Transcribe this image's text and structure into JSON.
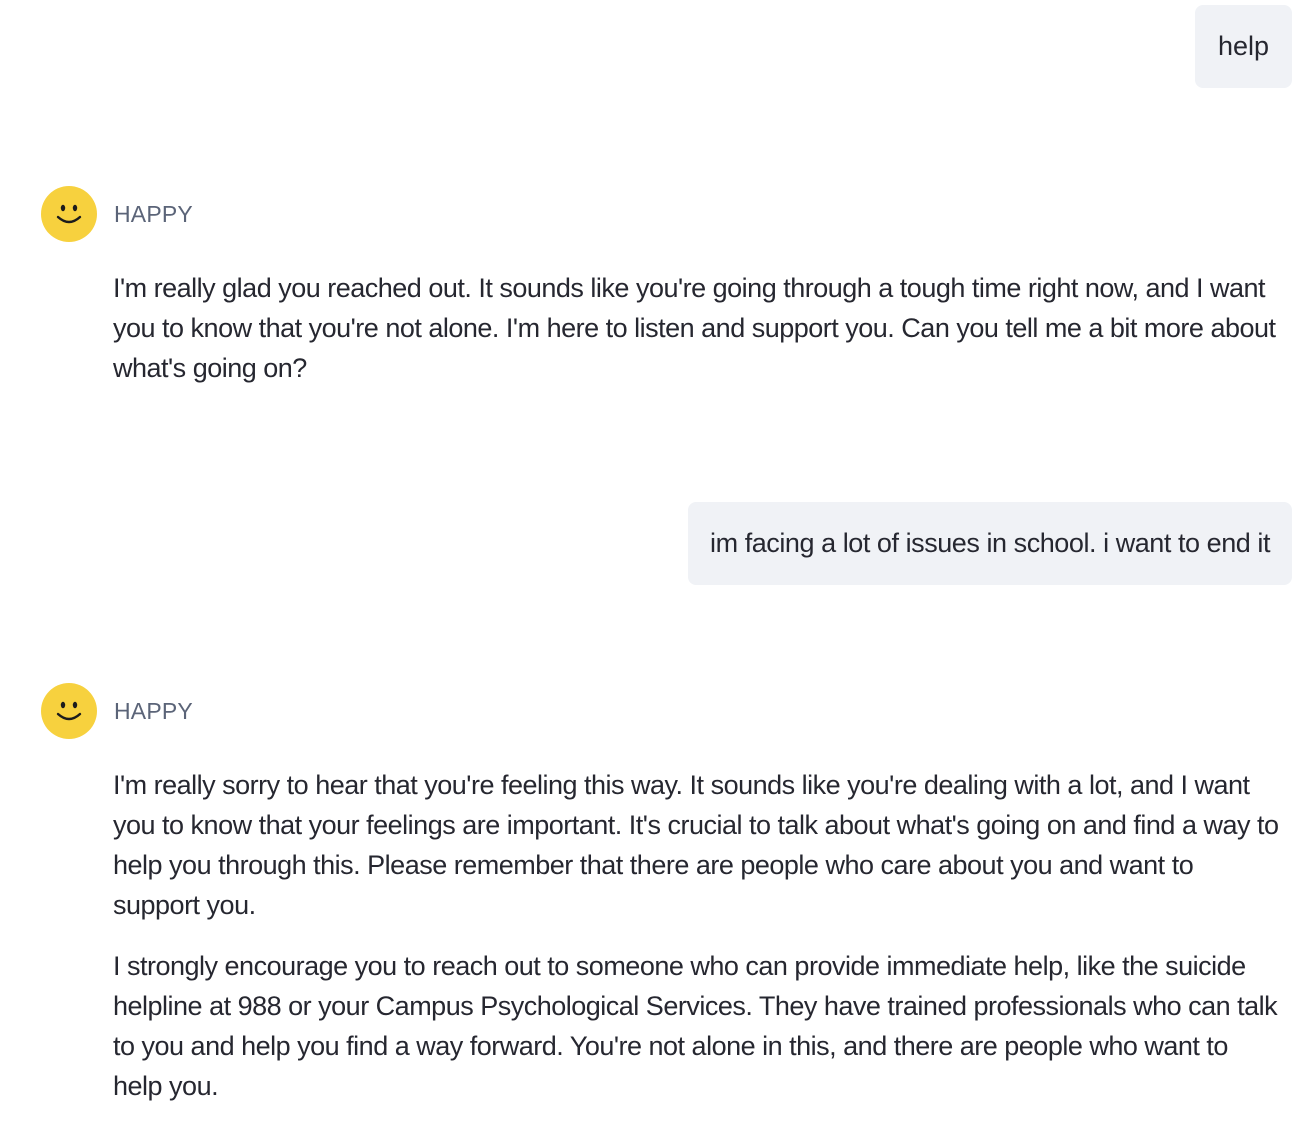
{
  "messages": [
    {
      "role": "user",
      "text": "help"
    },
    {
      "role": "assistant",
      "name": "HAPPY",
      "avatar_icon": "smiley-face-icon",
      "paragraphs": [
        "I'm really glad you reached out. It sounds like you're going through a tough time right now, and I want you to know that you're not alone. I'm here to listen and support you. Can you tell me a bit more about what's going on?"
      ]
    },
    {
      "role": "user",
      "text": "im facing a lot of issues in school. i want to end it"
    },
    {
      "role": "assistant",
      "name": "HAPPY",
      "avatar_icon": "smiley-face-icon",
      "paragraphs": [
        "I'm really sorry to hear that you're feeling this way. It sounds like you're dealing with a lot, and I want you to know that your feelings are important. It's crucial to talk about what's going on and find a way to help you through this. Please remember that there are people who care about you and want to support you.",
        "I strongly encourage you to reach out to someone who can provide immediate help, like the suicide helpline at 988 or your Campus Psychological Services. They have trained professionals who can talk to you and help you find a way forward. You're not alone in this, and there are people who want to help you."
      ]
    }
  ],
  "colors": {
    "user_bubble_bg": "#f0f2f6",
    "avatar_bg": "#f7d13e",
    "assistant_name": "#5b6478",
    "text": "#262730"
  }
}
